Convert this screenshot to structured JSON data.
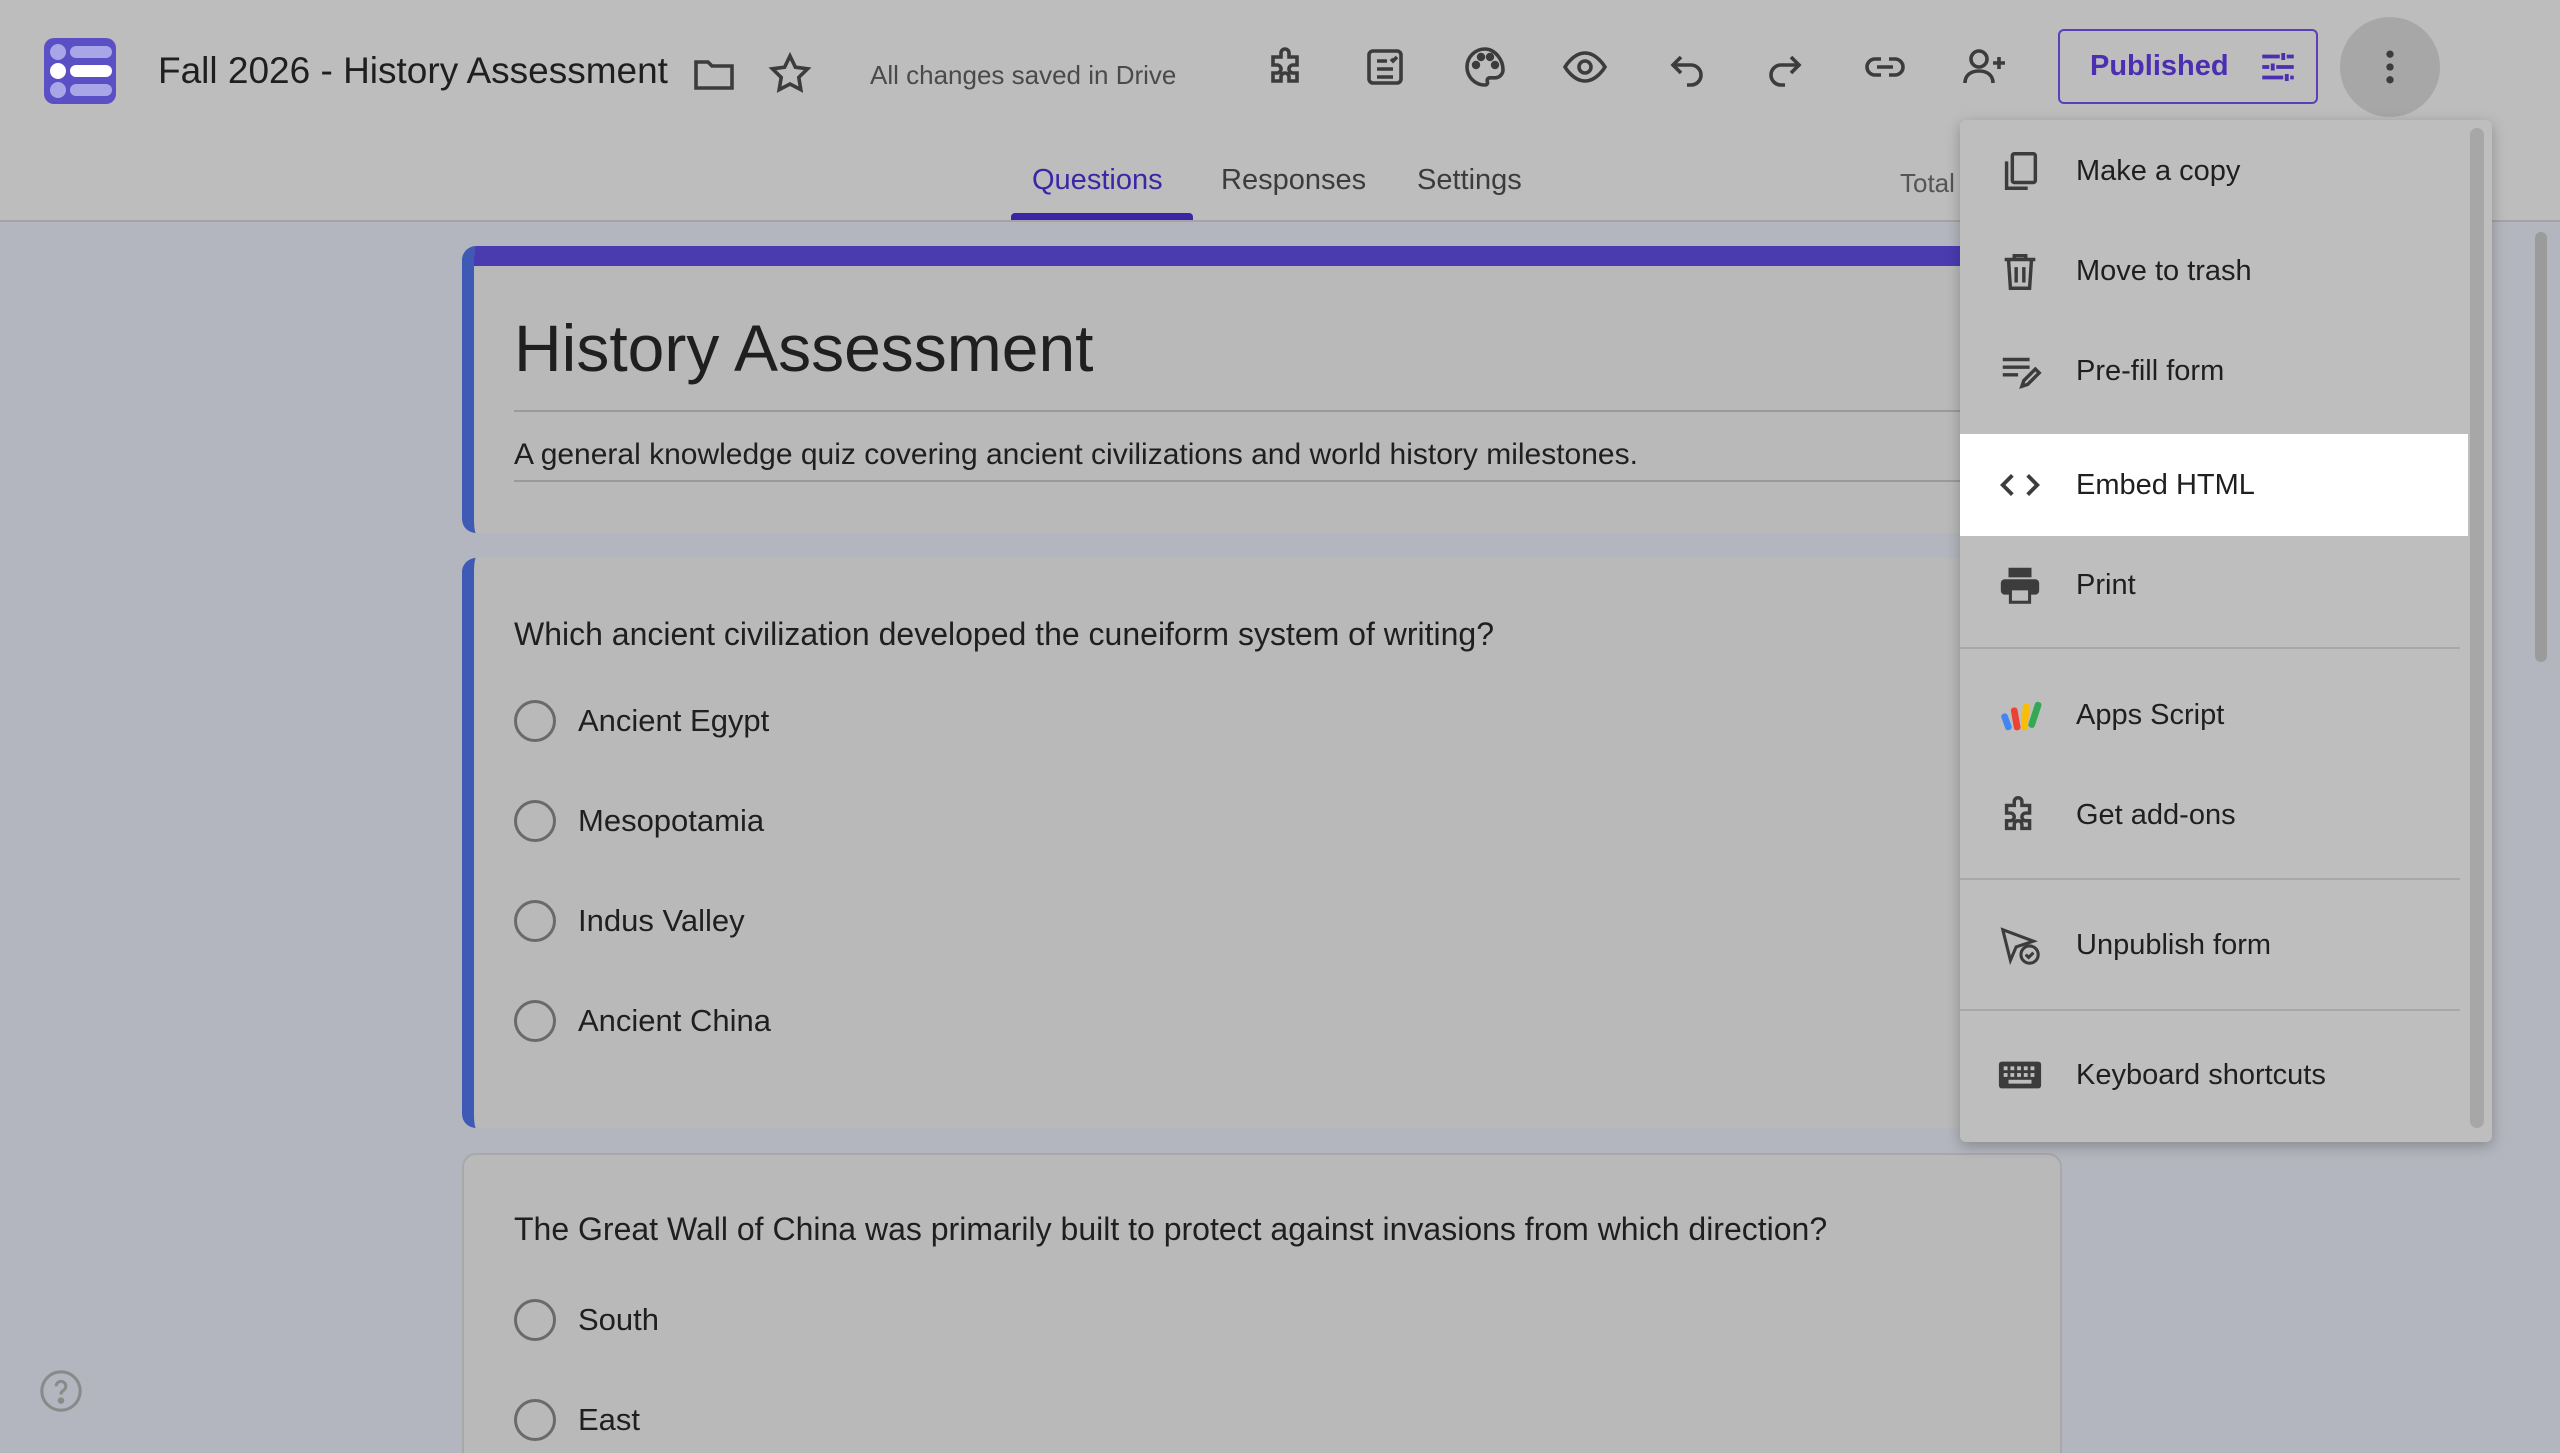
{
  "header": {
    "doc_title": "Fall 2026 - History Assessment",
    "save_status": "All changes saved in Drive",
    "published_label": "Published",
    "icons": [
      "folder-icon",
      "star-icon",
      "addons-icon",
      "quiz-summary-icon",
      "palette-icon",
      "preview-icon",
      "undo-icon",
      "redo-icon",
      "link-icon",
      "add-collaborator-icon",
      "more-vert-icon"
    ]
  },
  "tabs": [
    {
      "label": "Questions",
      "active": true
    },
    {
      "label": "Responses",
      "active": false
    },
    {
      "label": "Settings",
      "active": false
    }
  ],
  "total_label": "Total",
  "form": {
    "title": "History Assessment",
    "description": "A general knowledge quiz covering ancient civilizations and world history milestones."
  },
  "questions": [
    {
      "text": "Which ancient civilization developed the cuneiform system of writing?",
      "options": [
        "Ancient Egypt",
        "Mesopotamia",
        "Indus Valley",
        "Ancient China"
      ]
    },
    {
      "text": "The Great Wall of China was primarily built to protect against invasions from which direction?",
      "options": [
        "South",
        "East"
      ]
    }
  ],
  "menu": {
    "items": [
      {
        "label": "Make a copy",
        "icon": "copy-icon"
      },
      {
        "label": "Move to trash",
        "icon": "trash-icon"
      },
      {
        "label": "Pre-fill form",
        "icon": "prefill-icon"
      },
      {
        "label": "Embed HTML",
        "icon": "code-icon",
        "highlighted": true
      },
      {
        "label": "Print",
        "icon": "print-icon"
      },
      {
        "label": "Apps Script",
        "icon": "apps-script-icon"
      },
      {
        "label": "Get add-ons",
        "icon": "addons-icon"
      },
      {
        "label": "Unpublish form",
        "icon": "unpublish-icon"
      },
      {
        "label": "Keyboard shortcuts",
        "icon": "keyboard-icon"
      }
    ]
  },
  "colors": {
    "accent": "#3b27a6",
    "menu_highlight": "#ffffff",
    "overlay_background": "#b4b6bf"
  }
}
